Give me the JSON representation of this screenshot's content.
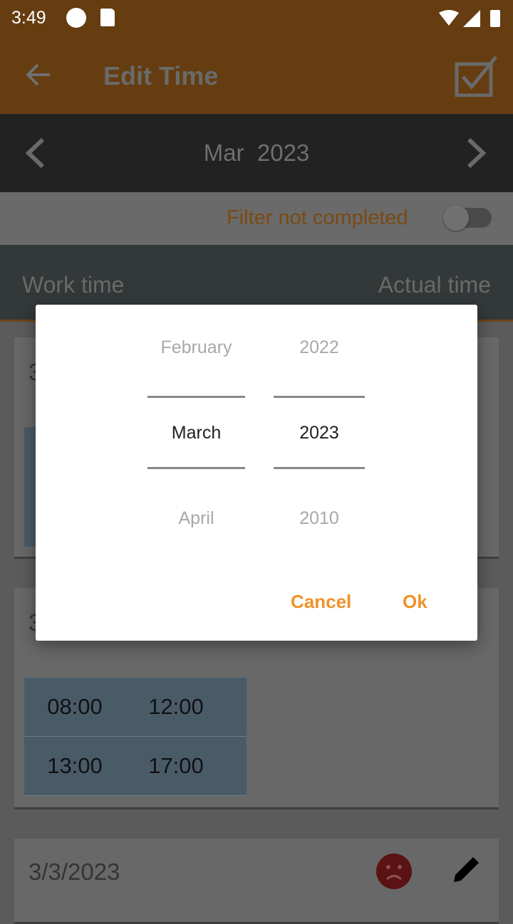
{
  "status_bar": {
    "time": "3:49"
  },
  "app_bar": {
    "title": "Edit Time",
    "back_icon": "arrow-left-icon",
    "confirm_icon": "checkbox-checked-icon"
  },
  "month_nav": {
    "label": "Mar  2023"
  },
  "filter": {
    "label": "Filter not completed",
    "enabled": false
  },
  "columns": {
    "left": "Work time",
    "right": "Actual time"
  },
  "cards": [
    {
      "date": "3",
      "times": []
    },
    {
      "date": "3",
      "times": [
        [
          "08:00",
          "12:00"
        ],
        [
          "13:00",
          "17:00"
        ]
      ]
    },
    {
      "date": "3/3/2023",
      "status_icon": "sad-face-icon"
    }
  ],
  "dialog": {
    "months": {
      "prev": "February",
      "selected": "March",
      "next": "April"
    },
    "years": {
      "prev": "2022",
      "selected": "2023",
      "next": "2010"
    },
    "cancel": "Cancel",
    "ok": "Ok"
  },
  "colors": {
    "accent": "#f0922a",
    "app_bar": "#653d10"
  }
}
